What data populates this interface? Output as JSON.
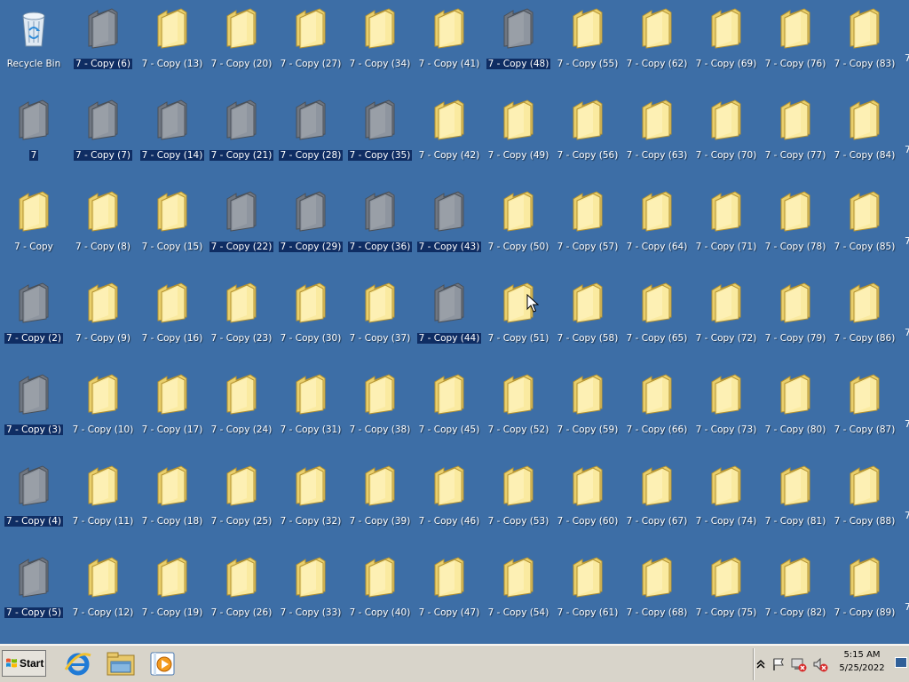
{
  "desktop": {
    "background": "#3d6ea6",
    "selection_color": "#0f2d63",
    "icons": [
      {
        "label": "Recycle Bin",
        "type": "recycle-bin",
        "selected": false
      },
      {
        "label": "7",
        "type": "folder",
        "selected": true
      },
      {
        "label": "7 - Copy",
        "type": "folder",
        "selected": false
      },
      {
        "label": "7 - Copy (2)",
        "type": "folder",
        "selected": true
      },
      {
        "label": "7 - Copy (3)",
        "type": "folder",
        "selected": true
      },
      {
        "label": "7 - Copy (4)",
        "type": "folder",
        "selected": true
      },
      {
        "label": "7 - Copy (5)",
        "type": "folder",
        "selected": true
      },
      {
        "label": "7 - Copy (6)",
        "type": "folder",
        "selected": true
      },
      {
        "label": "7 - Copy (7)",
        "type": "folder",
        "selected": true
      },
      {
        "label": "7 - Copy (8)",
        "type": "folder",
        "selected": false
      },
      {
        "label": "7 - Copy (9)",
        "type": "folder",
        "selected": false
      },
      {
        "label": "7 - Copy (10)",
        "type": "folder",
        "selected": false
      },
      {
        "label": "7 - Copy (11)",
        "type": "folder",
        "selected": false
      },
      {
        "label": "7 - Copy (12)",
        "type": "folder",
        "selected": false
      },
      {
        "label": "7 - Copy (13)",
        "type": "folder",
        "selected": false
      },
      {
        "label": "7 - Copy (14)",
        "type": "folder",
        "selected": true
      },
      {
        "label": "7 - Copy (15)",
        "type": "folder",
        "selected": false
      },
      {
        "label": "7 - Copy (16)",
        "type": "folder",
        "selected": false
      },
      {
        "label": "7 - Copy (17)",
        "type": "folder",
        "selected": false
      },
      {
        "label": "7 - Copy (18)",
        "type": "folder",
        "selected": false
      },
      {
        "label": "7 - Copy (19)",
        "type": "folder",
        "selected": false
      },
      {
        "label": "7 - Copy (20)",
        "type": "folder",
        "selected": false
      },
      {
        "label": "7 - Copy (21)",
        "type": "folder",
        "selected": true
      },
      {
        "label": "7 - Copy (22)",
        "type": "folder",
        "selected": true
      },
      {
        "label": "7 - Copy (23)",
        "type": "folder",
        "selected": false
      },
      {
        "label": "7 - Copy (24)",
        "type": "folder",
        "selected": false
      },
      {
        "label": "7 - Copy (25)",
        "type": "folder",
        "selected": false
      },
      {
        "label": "7 - Copy (26)",
        "type": "folder",
        "selected": false
      },
      {
        "label": "7 - Copy (27)",
        "type": "folder",
        "selected": false
      },
      {
        "label": "7 - Copy (28)",
        "type": "folder",
        "selected": true
      },
      {
        "label": "7 - Copy (29)",
        "type": "folder",
        "selected": true
      },
      {
        "label": "7 - Copy (30)",
        "type": "folder",
        "selected": false
      },
      {
        "label": "7 - Copy (31)",
        "type": "folder",
        "selected": false
      },
      {
        "label": "7 - Copy (32)",
        "type": "folder",
        "selected": false
      },
      {
        "label": "7 - Copy (33)",
        "type": "folder",
        "selected": false
      },
      {
        "label": "7 - Copy (34)",
        "type": "folder",
        "selected": false
      },
      {
        "label": "7 - Copy (35)",
        "type": "folder",
        "selected": true
      },
      {
        "label": "7 - Copy (36)",
        "type": "folder",
        "selected": true
      },
      {
        "label": "7 - Copy (37)",
        "type": "folder",
        "selected": false
      },
      {
        "label": "7 - Copy (38)",
        "type": "folder",
        "selected": false
      },
      {
        "label": "7 - Copy (39)",
        "type": "folder",
        "selected": false
      },
      {
        "label": "7 - Copy (40)",
        "type": "folder",
        "selected": false
      },
      {
        "label": "7 - Copy (41)",
        "type": "folder",
        "selected": false
      },
      {
        "label": "7 - Copy (42)",
        "type": "folder",
        "selected": false
      },
      {
        "label": "7 - Copy (43)",
        "type": "folder",
        "selected": true
      },
      {
        "label": "7 - Copy (44)",
        "type": "folder",
        "selected": true
      },
      {
        "label": "7 - Copy (45)",
        "type": "folder",
        "selected": false
      },
      {
        "label": "7 - Copy (46)",
        "type": "folder",
        "selected": false
      },
      {
        "label": "7 - Copy (47)",
        "type": "folder",
        "selected": false
      },
      {
        "label": "7 - Copy (48)",
        "type": "folder",
        "selected": true
      },
      {
        "label": "7 - Copy (49)",
        "type": "folder",
        "selected": false
      },
      {
        "label": "7 - Copy (50)",
        "type": "folder",
        "selected": false
      },
      {
        "label": "7 - Copy (51)",
        "type": "folder",
        "selected": false
      },
      {
        "label": "7 - Copy (52)",
        "type": "folder",
        "selected": false
      },
      {
        "label": "7 - Copy (53)",
        "type": "folder",
        "selected": false
      },
      {
        "label": "7 - Copy (54)",
        "type": "folder",
        "selected": false
      },
      {
        "label": "7 - Copy (55)",
        "type": "folder",
        "selected": false
      },
      {
        "label": "7 - Copy (56)",
        "type": "folder",
        "selected": false
      },
      {
        "label": "7 - Copy (57)",
        "type": "folder",
        "selected": false
      },
      {
        "label": "7 - Copy (58)",
        "type": "folder",
        "selected": false
      },
      {
        "label": "7 - Copy (59)",
        "type": "folder",
        "selected": false
      },
      {
        "label": "7 - Copy (60)",
        "type": "folder",
        "selected": false
      },
      {
        "label": "7 - Copy (61)",
        "type": "folder",
        "selected": false
      },
      {
        "label": "7 - Copy (62)",
        "type": "folder",
        "selected": false
      },
      {
        "label": "7 - Copy (63)",
        "type": "folder",
        "selected": false
      },
      {
        "label": "7 - Copy (64)",
        "type": "folder",
        "selected": false
      },
      {
        "label": "7 - Copy (65)",
        "type": "folder",
        "selected": false
      },
      {
        "label": "7 - Copy (66)",
        "type": "folder",
        "selected": false
      },
      {
        "label": "7 - Copy (67)",
        "type": "folder",
        "selected": false
      },
      {
        "label": "7 - Copy (68)",
        "type": "folder",
        "selected": false
      },
      {
        "label": "7 - Copy (69)",
        "type": "folder",
        "selected": false
      },
      {
        "label": "7 - Copy (70)",
        "type": "folder",
        "selected": false
      },
      {
        "label": "7 - Copy (71)",
        "type": "folder",
        "selected": false
      },
      {
        "label": "7 - Copy (72)",
        "type": "folder",
        "selected": false
      },
      {
        "label": "7 - Copy (73)",
        "type": "folder",
        "selected": false
      },
      {
        "label": "7 - Copy (74)",
        "type": "folder",
        "selected": false
      },
      {
        "label": "7 - Copy (75)",
        "type": "folder",
        "selected": false
      },
      {
        "label": "7 - Copy (76)",
        "type": "folder",
        "selected": false
      },
      {
        "label": "7 - Copy (77)",
        "type": "folder",
        "selected": false
      },
      {
        "label": "7 - Copy (78)",
        "type": "folder",
        "selected": false
      },
      {
        "label": "7 - Copy (79)",
        "type": "folder",
        "selected": false
      },
      {
        "label": "7 - Copy (80)",
        "type": "folder",
        "selected": false
      },
      {
        "label": "7 - Copy (81)",
        "type": "folder",
        "selected": false
      },
      {
        "label": "7 - Copy (82)",
        "type": "folder",
        "selected": false
      },
      {
        "label": "7 - Copy (83)",
        "type": "folder",
        "selected": false
      },
      {
        "label": "7 - Copy (84)",
        "type": "folder",
        "selected": false
      },
      {
        "label": "7 - Copy (85)",
        "type": "folder",
        "selected": false
      },
      {
        "label": "7 - Copy (86)",
        "type": "folder",
        "selected": false
      },
      {
        "label": "7 - Copy (87)",
        "type": "folder",
        "selected": false
      },
      {
        "label": "7 - Copy (88)",
        "type": "folder",
        "selected": false
      },
      {
        "label": "7 - Copy (89)",
        "type": "folder",
        "selected": false
      }
    ],
    "edge_text": "7"
  },
  "taskbar": {
    "start_label": "Start",
    "apps": [
      {
        "icon": "internet-explorer-icon"
      },
      {
        "icon": "windows-explorer-icon"
      },
      {
        "icon": "media-player-icon"
      }
    ],
    "tray": {
      "icons": [
        "show-hidden-icons-chevron",
        "action-center-flag-icon",
        "network-error-icon",
        "volume-muted-icon"
      ],
      "time": "5:15 AM",
      "date": "5/25/2022"
    }
  }
}
